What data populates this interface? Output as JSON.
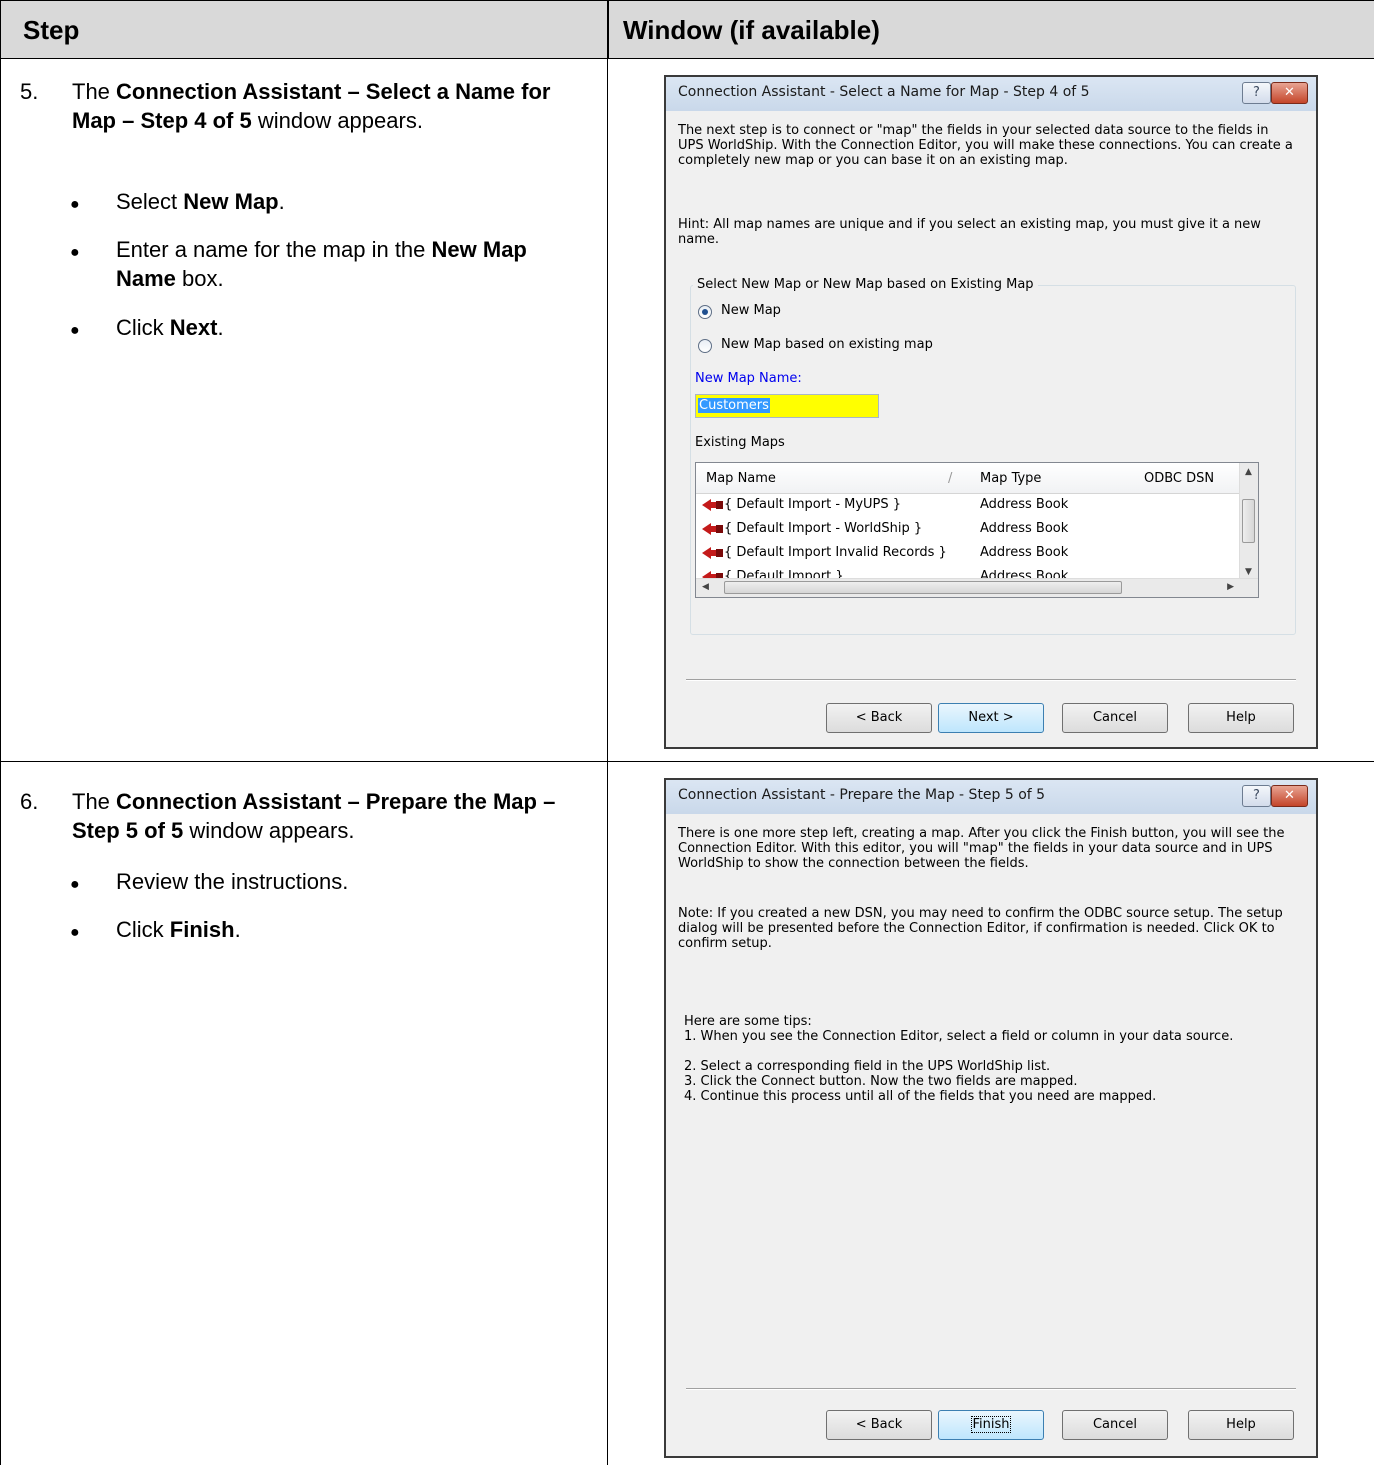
{
  "table": {
    "header_step": "Step",
    "header_window": "Window (if available)"
  },
  "step5": {
    "number": "5.",
    "intro_prefix": "The ",
    "intro_bold": "Connection Assistant – Select a Name for Map – Step 4 of 5",
    "intro_suffix": " window appears.",
    "bullet1_prefix": "Select ",
    "bullet1_bold": "New Map",
    "bullet1_suffix": ".",
    "bullet2_prefix": "Enter a name for the map in the ",
    "bullet2_bold": "New Map Name",
    "bullet2_suffix": " box.",
    "bullet3_prefix": "Click ",
    "bullet3_bold": "Next",
    "bullet3_suffix": "."
  },
  "step6": {
    "number": "6.",
    "intro_prefix": "The ",
    "intro_bold": "Connection Assistant – Prepare the Map – Step 5 of 5",
    "intro_suffix": " window appears.",
    "bullet1": "Review the instructions.",
    "bullet2_prefix": "Click ",
    "bullet2_bold": "Finish",
    "bullet2_suffix": "."
  },
  "dialog1": {
    "title": "Connection Assistant - Select a Name for Map - Step 4 of 5",
    "help_glyph": "?",
    "close_glyph": "✕",
    "paragraph": "The next step is to connect or \"map\" the fields in your selected data source to the fields in UPS WorldShip. With the Connection Editor, you will make these connections. You can create a completely new map or you can base it on an existing map.",
    "hint": "Hint: All map names are unique and if you select an existing map, you must give it a new name.",
    "group_label": "Select New Map or New Map based on Existing Map",
    "radio_new_map": "New Map",
    "radio_based_on_existing": "New Map based on existing map",
    "new_map_name_label": "New Map Name:",
    "new_map_name_value": "Customers",
    "existing_maps_label": "Existing Maps",
    "columns": [
      "Map Name",
      "Map Type",
      "ODBC DSN"
    ],
    "rows": [
      {
        "name": "{ Default Import - MyUPS }",
        "type": "Address Book"
      },
      {
        "name": "{ Default Import - WorldShip }",
        "type": "Address Book"
      },
      {
        "name": "{ Default Import Invalid Records }",
        "type": "Address Book"
      },
      {
        "name": "{ Default Import }",
        "type": "Address Book"
      }
    ],
    "buttons": {
      "back": "< Back",
      "next": "Next >",
      "cancel": "Cancel",
      "help": "Help"
    }
  },
  "dialog2": {
    "title": "Connection Assistant - Prepare the Map - Step 5 of 5",
    "help_glyph": "?",
    "close_glyph": "✕",
    "paragraph": "There is one more step left, creating a map. After you click the Finish button, you will see the Connection Editor. With this editor, you will  \"map\" the fields in your data source and in UPS WorldShip to show the connection between the fields.",
    "note": "Note: If you created a new DSN, you may need to confirm the ODBC source setup. The setup dialog will be presented before the Connection Editor, if confirmation is needed.  Click OK to confirm setup.",
    "tips_heading": "Here are some tips:",
    "tips": [
      "1. When you see the Connection Editor, select a field or column in your data source.",
      "2. Select a corresponding field in the  UPS WorldShip list.",
      "3. Click the Connect button. Now the two fields are mapped.",
      "4. Continue this process until all of the fields that you need are mapped."
    ],
    "buttons": {
      "back": "< Back",
      "finish": "Finish",
      "cancel": "Cancel",
      "help": "Help"
    }
  }
}
